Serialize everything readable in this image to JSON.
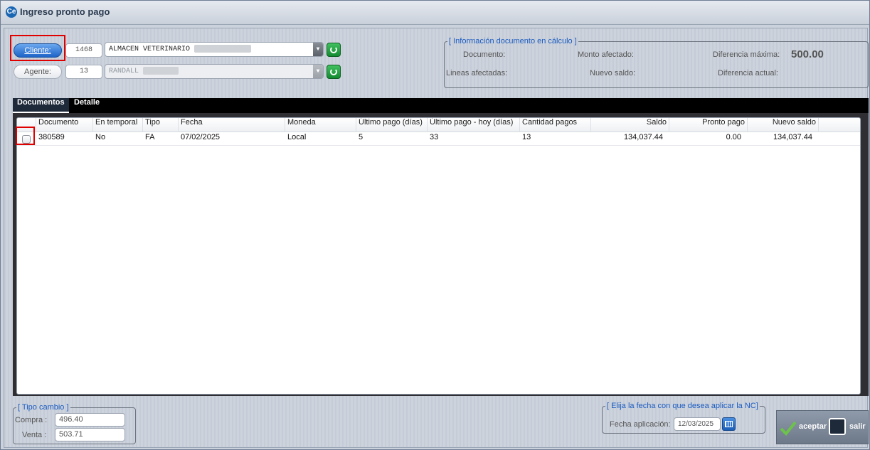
{
  "window": {
    "title": "Ingreso pronto pago",
    "logo": "Ce"
  },
  "cliente": {
    "button_label": "Cliente:",
    "code": "1468",
    "name": "ALMACEN VETERINARIO"
  },
  "agente": {
    "button_label": "Agente:",
    "code": "13",
    "name": "RANDALL"
  },
  "info_group": {
    "legend": "[ Información documento en cálculo ]",
    "documento_label": "Documento:",
    "monto_label": "Monto afectado:",
    "dif_max_label": "Diferencia máxima:",
    "dif_max_value": "500.00",
    "lineas_label": "Lineas afectadas:",
    "nuevo_saldo_label": "Nuevo saldo:",
    "dif_actual_label": "Diferencia actual:"
  },
  "tabs": [
    {
      "label": "Documentos",
      "active": true
    },
    {
      "label": "Detalle",
      "active": false
    }
  ],
  "table": {
    "columns": [
      "Documento",
      "En temporal",
      "Tipo",
      "Fecha",
      "Moneda",
      "Último pago (días)",
      "Último pago - hoy (días)",
      "Cantidad pagos",
      "Saldo",
      "Pronto pago",
      "Nuevo saldo"
    ],
    "rows": [
      [
        "380589",
        "No",
        "FA",
        "07/02/2025",
        "Local",
        "5",
        "33",
        "13",
        "134,037.44",
        "0.00",
        "134,037.44"
      ]
    ]
  },
  "tipo_cambio": {
    "legend": "[ Tipo cambio ]",
    "compra_label": "Compra :",
    "compra_value": "496.40",
    "venta_label": "Venta :",
    "venta_value": "503.71"
  },
  "fecha_group": {
    "legend": "[ Elija la fecha con que desea aplicar la NC]",
    "label": "Fecha aplicación:",
    "value": "12/03/2025"
  },
  "actions": {
    "accept_label": "aceptar",
    "exit_label": "salir"
  },
  "colors": {
    "accent": "#1e64c8",
    "highlight": "#e00000",
    "ok": "#6cc24a"
  }
}
